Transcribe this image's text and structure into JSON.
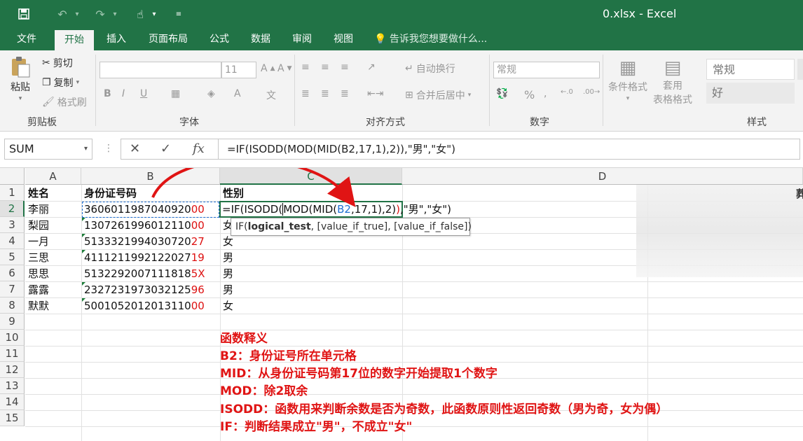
{
  "window": {
    "title": "0.xlsx - Excel"
  },
  "tabs": [
    {
      "label": "文件",
      "active": false
    },
    {
      "label": "开始",
      "active": true
    },
    {
      "label": "插入",
      "active": false
    },
    {
      "label": "页面布局",
      "active": false
    },
    {
      "label": "公式",
      "active": false
    },
    {
      "label": "数据",
      "active": false
    },
    {
      "label": "审阅",
      "active": false
    },
    {
      "label": "视图",
      "active": false
    }
  ],
  "tell_me": "告诉我您想要做什么...",
  "ribbon": {
    "paste": "粘贴",
    "cut": "剪切",
    "copy": "复制",
    "format_painter": "格式刷",
    "font_size": "11",
    "bold": "B",
    "italic": "I",
    "underline": "U",
    "wrap_text": "自动换行",
    "merge_center": "合并后居中",
    "number_format": "常规",
    "percent": "%",
    "conditional_format": "条件格式",
    "table_format_1": "套用",
    "table_format_2": "表格格式",
    "style_normal": "常规",
    "style_good": "好",
    "groups": {
      "clipboard": "剪贴板",
      "font": "字体",
      "alignment": "对齐方式",
      "number": "数字",
      "styles": "样式"
    }
  },
  "formula_bar": {
    "name_box": "SUM",
    "cancel": "✕",
    "enter": "✓",
    "fx": "fx",
    "formula": "=IF(ISODD(MOD(MID(B2,17,1),2)),\"男\",\"女\")"
  },
  "columns": [
    "A",
    "B",
    "C",
    "D"
  ],
  "rows": [
    "1",
    "2",
    "3",
    "4",
    "5",
    "6",
    "7",
    "8",
    "9",
    "10",
    "11",
    "12",
    "13",
    "14",
    "15"
  ],
  "sheet": {
    "headers": {
      "a": "姓名",
      "b": "身份证号码",
      "c": "性别"
    },
    "data": [
      {
        "name": "李丽",
        "id_main": "3606011987040920",
        "id_end": "00",
        "gender": ""
      },
      {
        "name": "梨园",
        "id_main": "1307261996012110",
        "id_end": "00",
        "gender": "女"
      },
      {
        "name": "一月",
        "id_main": "5133321994030720",
        "id_end": "27",
        "gender": "女"
      },
      {
        "name": "三思",
        "id_main": "4111211992122027",
        "id_end": "19",
        "gender": "男"
      },
      {
        "name": "思思",
        "id_main": "5132292007111818",
        "id_end": "5X",
        "gender": "男"
      },
      {
        "name": "露露",
        "id_main": "2327231973032125",
        "id_end": "96",
        "gender": "男"
      },
      {
        "name": "默默",
        "id_main": "5001052012013110",
        "id_end": "00",
        "gender": "女"
      }
    ],
    "editing_formula": {
      "p1": "=IF(ISODD(",
      "p2": "MOD(MID(",
      "p3": "B2",
      "p4": ",17,1),2)",
      "p5": ")",
      "p6": ",\"男\",\"女\")"
    },
    "tooltip": {
      "prefix": "IF(",
      "bold": "logical_test",
      "rest": ", [value_if_true], [value_if_false])"
    }
  },
  "notes": [
    "函数释义",
    "B2：身份证号所在单元格",
    "MID：从身份证号码第17位的数字开始提取1个数字",
    "MOD：除2取余",
    "ISODD：函数用来判断余数是否为奇数，此函数原则性返回奇数（男为奇，女为偶）",
    "IF：判断结果成立\"男\"，不成立\"女\""
  ],
  "colors": {
    "excel_green": "#217346",
    "annotation_red": "#e01414"
  }
}
